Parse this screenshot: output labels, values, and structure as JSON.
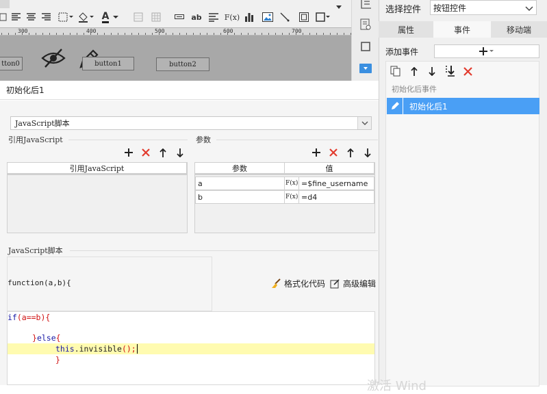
{
  "toolbar": {
    "tools": [
      "table-style-icon",
      "align-left-icon",
      "align-center-icon",
      "align-right-icon",
      "border-icon",
      "fill-color-icon",
      "font-color-icon",
      "merge-cells-icon",
      "grid-icon",
      "input-icon",
      "text-icon",
      "paragraph-icon",
      "formula-icon",
      "bar-chart-icon",
      "image-icon",
      "slash-icon",
      "cell-elements-icon"
    ],
    "font_color_letter": "A",
    "formula_label": "F(x)",
    "text_label": "ab"
  },
  "ruler": {
    "ticks": [
      "300",
      "400",
      "500",
      "600",
      "700"
    ]
  },
  "canvas": {
    "buttons": [
      "tton0",
      "button1",
      "button2"
    ]
  },
  "left": {
    "title": "初始化后1",
    "script_type": "JavaScript脚本",
    "ref_group_title": "引用JavaScript",
    "ref_table_header": "引用JavaScript",
    "params_group_title": "参数",
    "params_headers": [
      "参数",
      "值"
    ],
    "params": [
      {
        "name": "a",
        "formula": "F(x)",
        "value": "=$fine_username"
      },
      {
        "name": "b",
        "formula": "F(x)",
        "value": "=d4"
      }
    ],
    "script_group_title": "JavaScript脚本",
    "function_signature": "function(a,b){",
    "format_code": "格式化代码",
    "advanced_edit": "高级编辑",
    "code": {
      "line1_kw": "if",
      "line1_rest": "(a==b){",
      "line3_brace": "}",
      "line3_kw": "else",
      "line3_open": "{",
      "line4_kw": "this",
      "line4_method": ".invisible",
      "line4_call": "();",
      "line5": "}"
    }
  },
  "right": {
    "select_label": "选择控件",
    "select_value": "按钮控件",
    "tabs": [
      "属性",
      "事件",
      "移动端"
    ],
    "active_tab": "事件",
    "add_event_label": "添加事件",
    "event_category": "初始化后事件",
    "event_item": "初始化后1"
  },
  "watermark": "激活 Wind",
  "colors": {
    "selection": "#4a9ff5",
    "delete_red": "#e23b2e",
    "code_highlight": "#fffbb0",
    "keyword_blue": "#1a1aa6",
    "brace_red": "#d01010"
  }
}
